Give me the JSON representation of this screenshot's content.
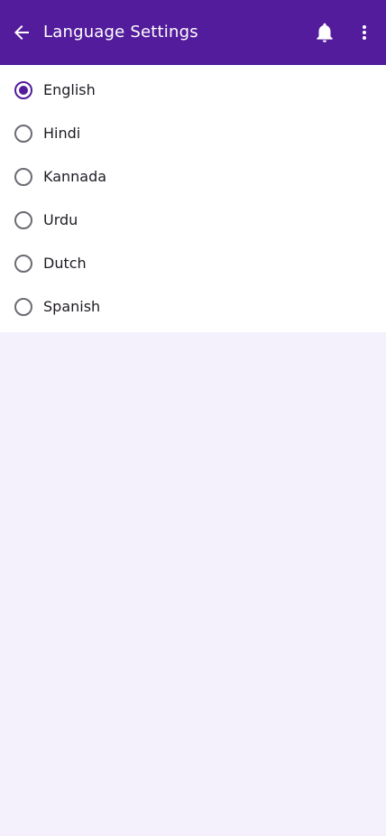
{
  "header": {
    "title": "Language Settings",
    "back_icon": "arrow-back-icon",
    "notification_icon": "bell-icon",
    "menu_icon": "more-vert-icon"
  },
  "languages": {
    "selected": "English",
    "options": [
      {
        "label": "English",
        "checked": true
      },
      {
        "label": "Hindi",
        "checked": false
      },
      {
        "label": "Kannada",
        "checked": false
      },
      {
        "label": "Urdu",
        "checked": false
      },
      {
        "label": "Dutch",
        "checked": false
      },
      {
        "label": "Spanish",
        "checked": false
      }
    ]
  },
  "colors": {
    "app_bar": "#531c9c",
    "background": "#f4f1fd",
    "radio_selected": "#531c9c",
    "radio_unselected": "#6b6b73"
  }
}
